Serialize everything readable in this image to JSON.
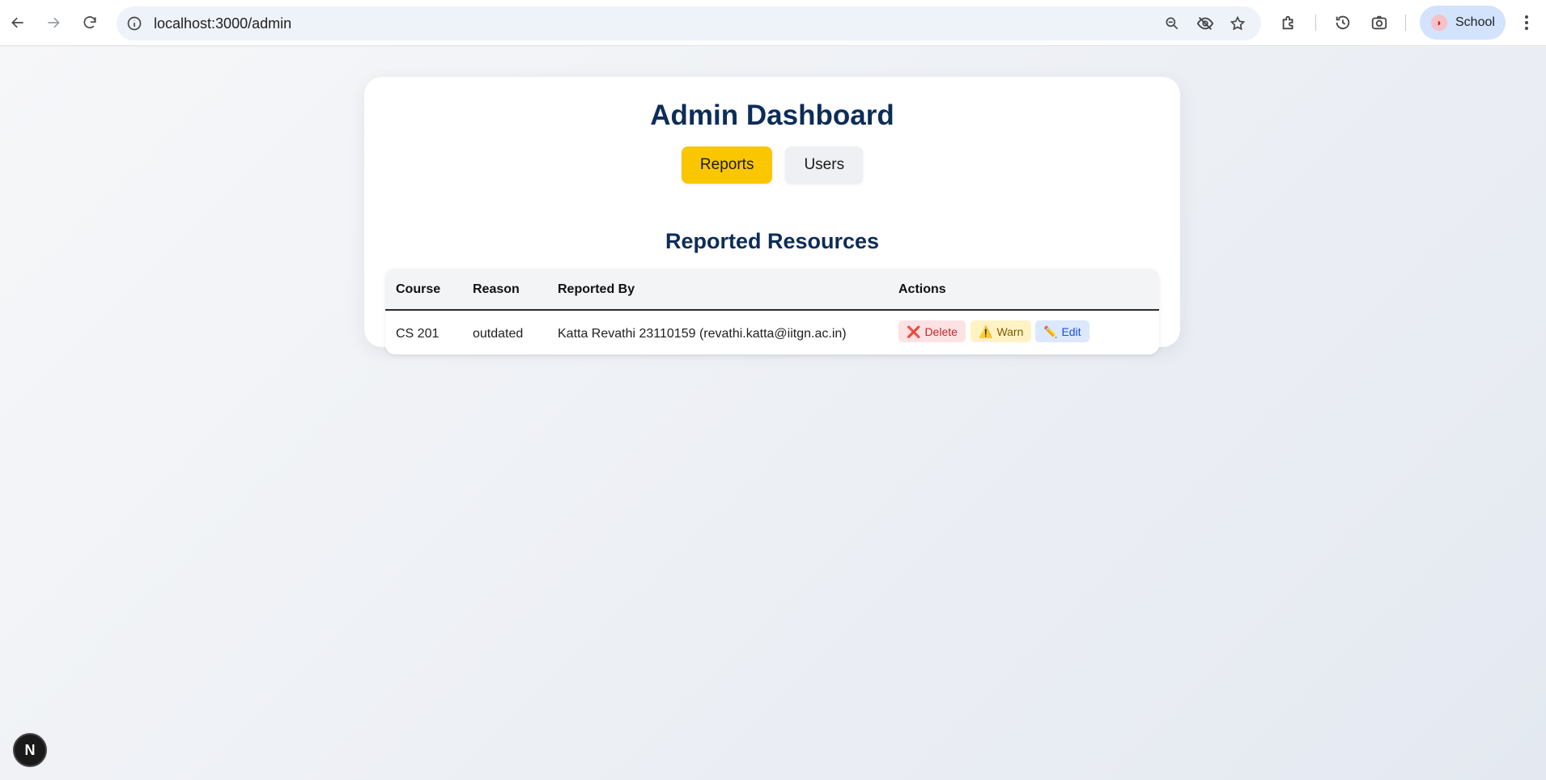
{
  "browser": {
    "url": "localhost:3000/admin",
    "profile_name": "School",
    "icons": {
      "back": "arrow-left-icon",
      "forward": "arrow-right-icon",
      "reload": "reload-icon",
      "site_info": "info-icon",
      "zoom": "zoom-out-icon",
      "tracking": "eye-off-icon",
      "bookmark": "star-icon",
      "extensions": "puzzle-icon",
      "history": "history-icon",
      "lens": "camera-search-icon",
      "menu": "kebab-menu-icon"
    }
  },
  "page": {
    "title": "Admin Dashboard",
    "tabs": [
      {
        "label": "Reports",
        "active": true
      },
      {
        "label": "Users",
        "active": false
      }
    ],
    "section_title": "Reported Resources",
    "table": {
      "headers": [
        "Course",
        "Reason",
        "Reported By",
        "Actions"
      ],
      "rows": [
        {
          "course": "CS 201",
          "reason": "outdated",
          "reported_by": "Katta Revathi 23110159 (revathi.katta@iitgn.ac.in)",
          "actions": {
            "delete": {
              "icon": "❌",
              "label": "Delete"
            },
            "warn": {
              "icon": "⚠️",
              "label": "Warn"
            },
            "edit": {
              "icon": "✏️",
              "label": "Edit"
            }
          }
        }
      ]
    }
  },
  "dev_badge": {
    "label": "N"
  },
  "colors": {
    "accent": "#f9c600",
    "heading": "#0c2d57",
    "delete": "#c0262d",
    "warn": "#7a5a00",
    "edit": "#1d4ed8"
  }
}
